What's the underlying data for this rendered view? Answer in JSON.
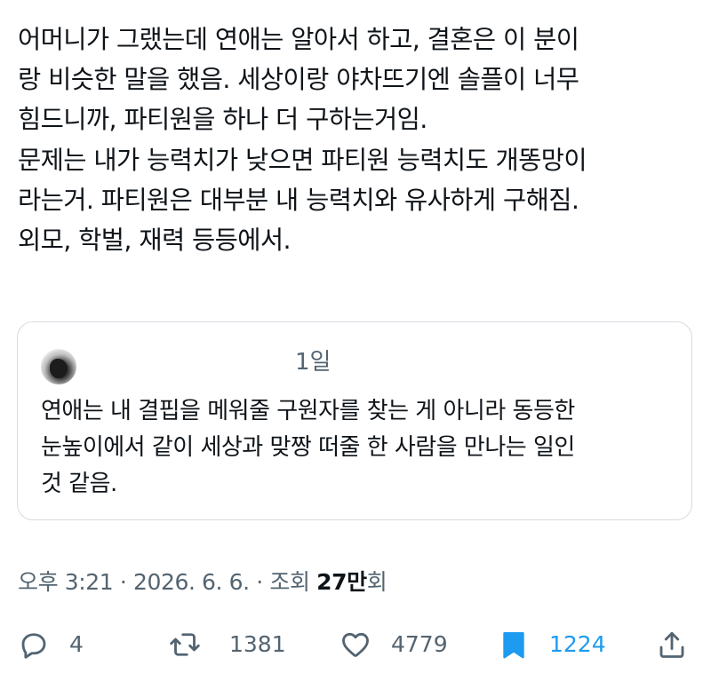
{
  "post": {
    "text_lines": [
      "어머니가 그랬는데 연애는 알아서 하고, 결혼은 이 분이",
      "랑 비슷한 말을 했음. 세상이랑 야차뜨기엔 솔플이 너무",
      "힘드니까, 파티원을 하나 더 구하는거임.",
      "문제는 내가 능력치가 낮으면 파티원 능력치도 개똥망이",
      "라는거. 파티원은 대부분 내 능력치와 유사하게 구해짐.",
      "외모, 학벌, 재력 등등에서."
    ]
  },
  "quote": {
    "avatar_icon": "profile-avatar",
    "time": "1일",
    "text_lines": [
      "연애는 내 결핍을 메워줄 구원자를 찾는 게 아니라 동등한",
      "눈높이에서 같이 세상과 맞짱 떠줄 한 사람을 만나는 일인",
      "것 같음."
    ]
  },
  "meta": {
    "time": "오후 3:21",
    "separator": " · ",
    "date": "2026. 6. 6.",
    "views_prefix": "조회 ",
    "views_count": "27만",
    "views_suffix": "회"
  },
  "actions": {
    "reply": {
      "icon": "reply-icon",
      "count": "4"
    },
    "repost": {
      "icon": "repost-icon",
      "count": "1381"
    },
    "like": {
      "icon": "heart-icon",
      "count": "4779"
    },
    "bookmark": {
      "icon": "bookmark-icon",
      "count": "1224"
    },
    "share": {
      "icon": "share-icon"
    }
  },
  "colors": {
    "text": "#0f1419",
    "secondary": "#536471",
    "accent": "#1d9bf0",
    "border": "#d7dbe0"
  }
}
